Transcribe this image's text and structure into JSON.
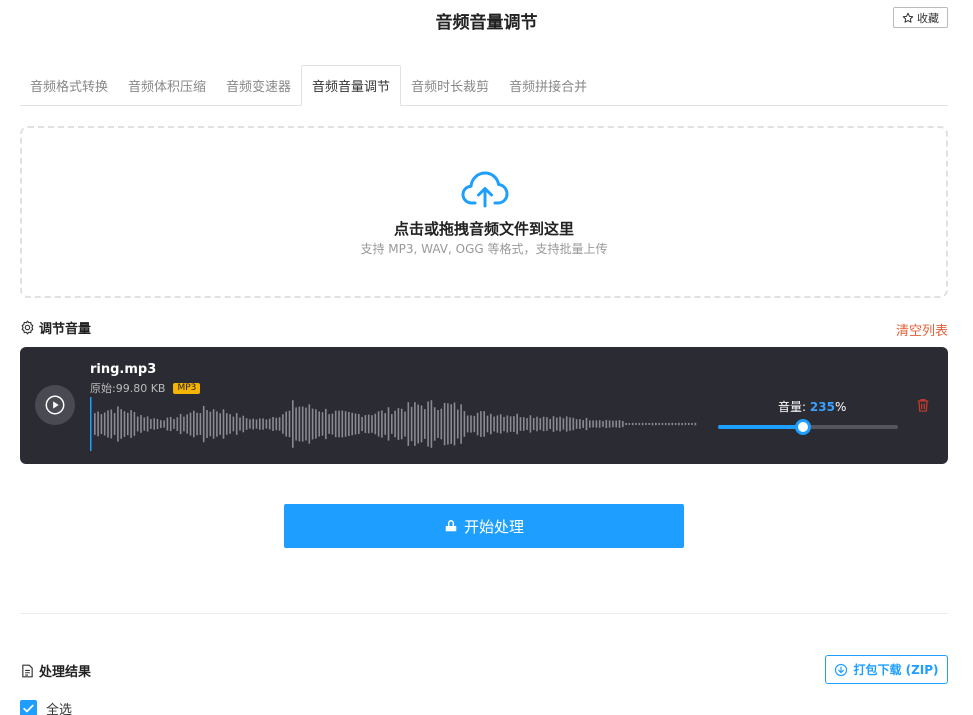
{
  "header": {
    "title": "音频音量调节",
    "favorite_label": "收藏"
  },
  "tabs": [
    {
      "label": "音频格式转换",
      "active": false
    },
    {
      "label": "音频体积压缩",
      "active": false
    },
    {
      "label": "音频变速器",
      "active": false
    },
    {
      "label": "音频音量调节",
      "active": true
    },
    {
      "label": "音频时长裁剪",
      "active": false
    },
    {
      "label": "音频拼接合并",
      "active": false
    }
  ],
  "upload": {
    "icon": "cloud-upload-icon",
    "main_text": "点击或拖拽音频文件到这里",
    "sub_text": "支持 MP3, WAV, OGG 等格式，支持批量上传"
  },
  "section": {
    "title": "调节音量",
    "clear_label": "清空列表"
  },
  "file": {
    "name": "ring.mp3",
    "original_size": "原始:99.80 KB",
    "format": "MP3",
    "volume_label": "音量:",
    "volume_value": "235",
    "volume_unit": "%",
    "volume_slider_fraction": 0.47
  },
  "actions": {
    "start_label": "开始处理"
  },
  "results": {
    "title": "处理结果",
    "zip_label": "打包下载 (ZIP)",
    "select_all_label": "全选",
    "select_all_checked": true
  },
  "colors": {
    "accent": "#1e9fff",
    "danger": "#e0603a",
    "card_bg": "#2b2b33",
    "badge": "#f5b400"
  }
}
